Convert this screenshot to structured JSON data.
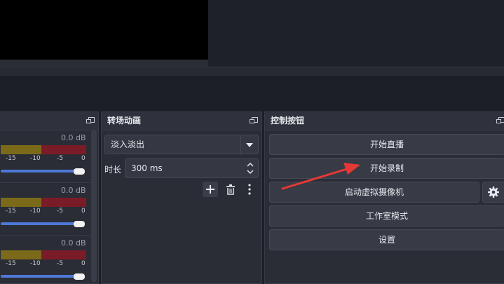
{
  "mixer": {
    "channels": [
      {
        "db": "0.0 dB",
        "ticks": [
          "-15",
          "-10",
          "-5",
          "0"
        ]
      },
      {
        "db": "0.0 dB",
        "ticks": [
          "-15",
          "-10",
          "-5",
          "0"
        ]
      },
      {
        "db": "0.0 dB",
        "ticks": [
          "-15",
          "-10",
          "-5",
          "0"
        ]
      }
    ]
  },
  "transitions": {
    "title": "转场动画",
    "selected": "淡入淡出",
    "duration_label": "时长",
    "duration_value": "300 ms"
  },
  "controls": {
    "title": "控制按钮",
    "start_stream": "开始直播",
    "start_record": "开始录制",
    "start_virtual_cam": "启动虚拟摄像机",
    "studio_mode": "工作室模式",
    "settings": "设置"
  },
  "colors": {
    "arrow": "#e53935",
    "volume_slider": "#4e78d8",
    "meter_yellow": "#7a6a1a",
    "meter_red": "#7a1c28"
  }
}
